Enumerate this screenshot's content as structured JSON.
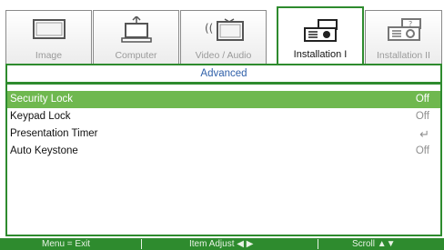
{
  "tabs": [
    {
      "label": "Image",
      "icon": "monitor-icon",
      "active": false
    },
    {
      "label": "Computer",
      "icon": "computer-icon",
      "active": false
    },
    {
      "label": "Video / Audio",
      "icon": "video-audio-icon",
      "active": false
    },
    {
      "label": "Installation I",
      "icon": "projector-icon",
      "active": true
    },
    {
      "label": "Installation II",
      "icon": "projector-settings-icon",
      "active": false
    }
  ],
  "panel": {
    "subtitle": "Advanced",
    "rows": [
      {
        "name": "Security Lock",
        "value": "Off",
        "selected": true
      },
      {
        "name": "Keypad Lock",
        "value": "Off",
        "selected": false
      },
      {
        "name": "Presentation Timer",
        "value": "↵",
        "selected": false
      },
      {
        "name": "Auto Keystone",
        "value": "Off",
        "selected": false
      }
    ]
  },
  "footer": {
    "menu_exit": "Menu = Exit",
    "item_adjust": "Item Adjust ◀ ▶",
    "scroll": "Scroll ▲▼"
  },
  "colors": {
    "accent": "#2e8b2e",
    "selected_row": "#6fb84f",
    "subtitle_text": "#2e5fa8"
  }
}
